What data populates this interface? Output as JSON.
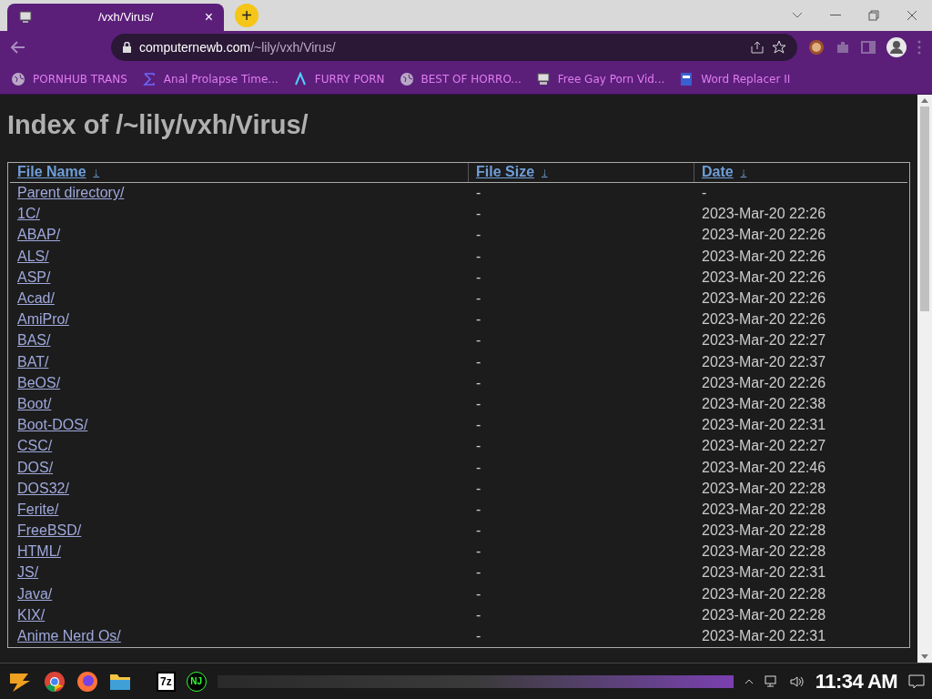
{
  "tab": {
    "title": "/vxh/Virus/",
    "close": "×",
    "new_tab": "+"
  },
  "address": {
    "host": "computernewb.com",
    "path": "/~lily/vxh/Virus/"
  },
  "bookmarks": [
    {
      "kind": "globe",
      "label": "PORNHUB TRANS"
    },
    {
      "kind": "sigma",
      "label": "Anal Prolapse Time..."
    },
    {
      "kind": "lambda",
      "label": "FURRY PORN"
    },
    {
      "kind": "globe",
      "label": "BEST OF HORRO..."
    },
    {
      "kind": "computer",
      "label": "Free Gay Porn Vid..."
    },
    {
      "kind": "wr",
      "label": "Word Replacer II"
    }
  ],
  "page": {
    "heading": "Index of /~lily/vxh/Virus/",
    "columns": [
      {
        "label": "File Name",
        "sort": "↓"
      },
      {
        "label": "File Size",
        "sort": "↓"
      },
      {
        "label": "Date",
        "sort": "↓"
      }
    ],
    "rows": [
      {
        "name": "Parent directory/",
        "size": "-",
        "date": "-"
      },
      {
        "name": "1C/",
        "size": "-",
        "date": "2023-Mar-20 22:26"
      },
      {
        "name": "ABAP/",
        "size": "-",
        "date": "2023-Mar-20 22:26"
      },
      {
        "name": "ALS/",
        "size": "-",
        "date": "2023-Mar-20 22:26"
      },
      {
        "name": "ASP/",
        "size": "-",
        "date": "2023-Mar-20 22:26"
      },
      {
        "name": "Acad/",
        "size": "-",
        "date": "2023-Mar-20 22:26"
      },
      {
        "name": "AmiPro/",
        "size": "-",
        "date": "2023-Mar-20 22:26"
      },
      {
        "name": "BAS/",
        "size": "-",
        "date": "2023-Mar-20 22:27"
      },
      {
        "name": "BAT/",
        "size": "-",
        "date": "2023-Mar-20 22:37"
      },
      {
        "name": "BeOS/",
        "size": "-",
        "date": "2023-Mar-20 22:26"
      },
      {
        "name": "Boot/",
        "size": "-",
        "date": "2023-Mar-20 22:38"
      },
      {
        "name": "Boot-DOS/",
        "size": "-",
        "date": "2023-Mar-20 22:31"
      },
      {
        "name": "CSC/",
        "size": "-",
        "date": "2023-Mar-20 22:27"
      },
      {
        "name": "DOS/",
        "size": "-",
        "date": "2023-Mar-20 22:46"
      },
      {
        "name": "DOS32/",
        "size": "-",
        "date": "2023-Mar-20 22:28"
      },
      {
        "name": "Ferite/",
        "size": "-",
        "date": "2023-Mar-20 22:28"
      },
      {
        "name": "FreeBSD/",
        "size": "-",
        "date": "2023-Mar-20 22:28"
      },
      {
        "name": "HTML/",
        "size": "-",
        "date": "2023-Mar-20 22:28"
      },
      {
        "name": "JS/",
        "size": "-",
        "date": "2023-Mar-20 22:31"
      },
      {
        "name": "Java/",
        "size": "-",
        "date": "2023-Mar-20 22:28"
      },
      {
        "name": "KIX/",
        "size": "-",
        "date": "2023-Mar-20 22:28"
      },
      {
        "name": "Anime Nerd Os/",
        "size": "-",
        "date": "2023-Mar-20 22:31"
      }
    ]
  },
  "taskbar": {
    "apps": [
      {
        "kind": "start"
      },
      {
        "kind": "chrome"
      },
      {
        "kind": "firefox"
      },
      {
        "kind": "folder"
      },
      {
        "kind": "archiver",
        "label": "7z"
      },
      {
        "kind": "nj",
        "label": "NJ"
      }
    ],
    "time": "11:34 AM"
  }
}
